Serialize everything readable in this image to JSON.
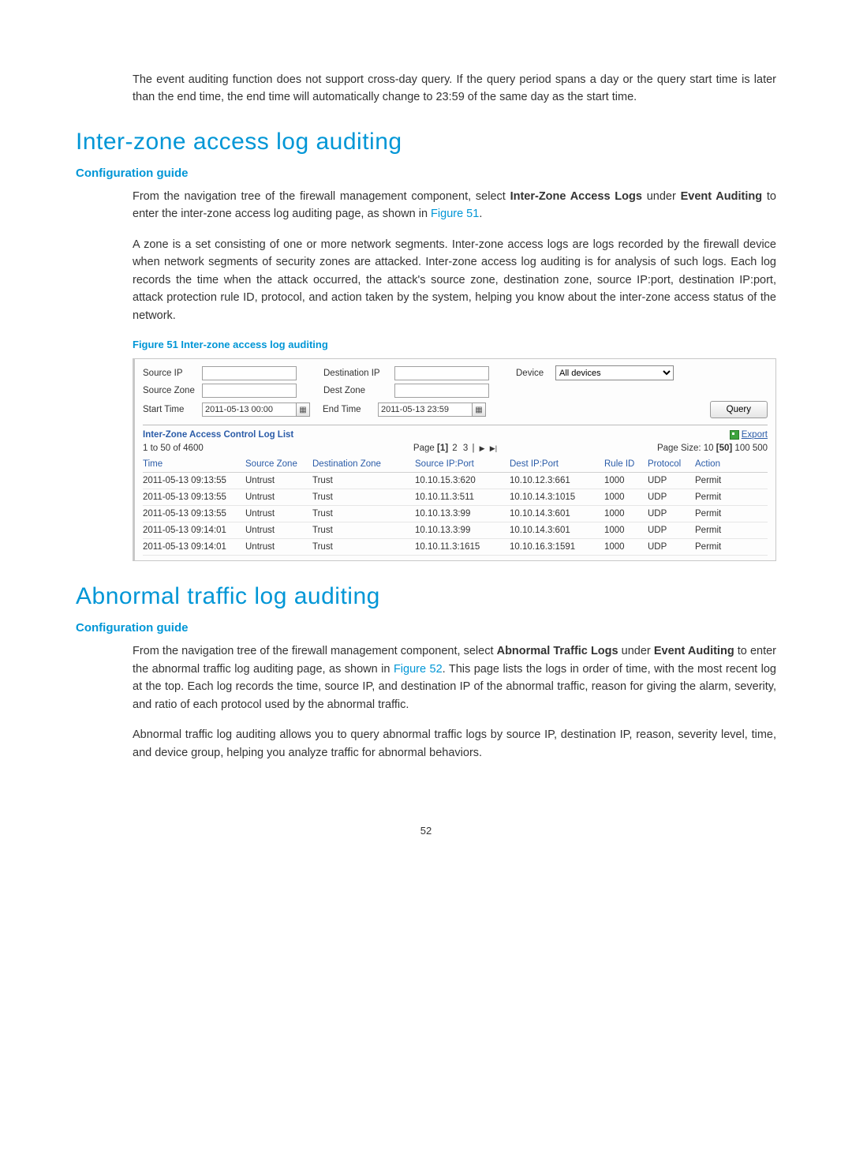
{
  "intro_paragraph": "The event auditing function does not support cross-day query. If the query period spans a day or the query start time is later than the end time, the end time will automatically change to 23:59 of the same day as the start time.",
  "section1": {
    "title": "Inter-zone access log auditing",
    "config_guide_label": "Configuration guide",
    "p1_pre": "From the navigation tree of the firewall management component, select ",
    "p1_bold1": "Inter-Zone Access Logs",
    "p1_mid": " under ",
    "p1_bold2": "Event Auditing",
    "p1_mid2": " to enter the inter-zone access log auditing page, as shown in ",
    "p1_link": "Figure 51",
    "p1_end": ".",
    "p2": "A zone is a set consisting of one or more network segments. Inter-zone access logs are logs recorded by the firewall device when network segments of security zones are attacked. Inter-zone access log auditing is for analysis of such logs. Each log records the time when the attack occurred, the attack's source zone, destination zone, source IP:port, destination IP:port, attack protection rule ID, protocol, and action taken by the system, helping you know about the inter-zone access status of the network.",
    "figure_caption": "Figure 51 Inter-zone access log auditing"
  },
  "figure": {
    "labels": {
      "source_ip": "Source IP",
      "destination_ip": "Destination IP",
      "device": "Device",
      "source_zone": "Source Zone",
      "dest_zone": "Dest Zone",
      "start_time": "Start Time",
      "end_time": "End Time",
      "query": "Query"
    },
    "values": {
      "device_selected": "All devices",
      "start_time": "2011-05-13 00:00",
      "end_time": "2011-05-13 23:59"
    },
    "list_title": "Inter-Zone Access Control Log List",
    "export_label": "Export",
    "range": "1 to 50 of 4600",
    "pager": {
      "prefix": "Page ",
      "current": "[1]",
      "p2": "2",
      "p3": "3",
      "sep": "|",
      "next": "▶",
      "last": "▶|"
    },
    "page_size_label": "Page Size: ",
    "page_size_10": "10",
    "page_size_50": "[50]",
    "page_size_100": "100",
    "page_size_500": "500",
    "columns": [
      "Time",
      "Source Zone",
      "Destination Zone",
      "Source IP:Port",
      "Dest IP:Port",
      "Rule ID",
      "Protocol",
      "Action"
    ],
    "rows": [
      {
        "time": "2011-05-13 09:13:55",
        "sz": "Untrust",
        "dz": "Trust",
        "sip": "10.10.15.3:620",
        "dip": "10.10.12.3:661",
        "rid": "1000",
        "proto": "UDP",
        "act": "Permit"
      },
      {
        "time": "2011-05-13 09:13:55",
        "sz": "Untrust",
        "dz": "Trust",
        "sip": "10.10.11.3:511",
        "dip": "10.10.14.3:1015",
        "rid": "1000",
        "proto": "UDP",
        "act": "Permit"
      },
      {
        "time": "2011-05-13 09:13:55",
        "sz": "Untrust",
        "dz": "Trust",
        "sip": "10.10.13.3:99",
        "dip": "10.10.14.3:601",
        "rid": "1000",
        "proto": "UDP",
        "act": "Permit"
      },
      {
        "time": "2011-05-13 09:14:01",
        "sz": "Untrust",
        "dz": "Trust",
        "sip": "10.10.13.3:99",
        "dip": "10.10.14.3:601",
        "rid": "1000",
        "proto": "UDP",
        "act": "Permit"
      },
      {
        "time": "2011-05-13 09:14:01",
        "sz": "Untrust",
        "dz": "Trust",
        "sip": "10.10.11.3:1615",
        "dip": "10.10.16.3:1591",
        "rid": "1000",
        "proto": "UDP",
        "act": "Permit"
      }
    ]
  },
  "section2": {
    "title": "Abnormal traffic log auditing",
    "config_guide_label": "Configuration guide",
    "p1_pre": "From the navigation tree of the firewall management component, select ",
    "p1_bold1": "Abnormal Traffic Logs",
    "p1_mid": " under ",
    "p1_bold2": "Event Auditing",
    "p1_mid2": " to enter the abnormal traffic log auditing page, as shown in ",
    "p1_link": "Figure 52",
    "p1_end": ". This page lists the logs in order of time, with the most recent log at the top. Each log records the time, source IP, and destination IP of the abnormal traffic, reason for giving the alarm, severity, and ratio of each protocol used by the abnormal traffic.",
    "p2": "Abnormal traffic log auditing allows you to query abnormal traffic logs by source IP, destination IP, reason, severity level, time, and device group, helping you analyze traffic for abnormal behaviors."
  },
  "page_number": "52"
}
